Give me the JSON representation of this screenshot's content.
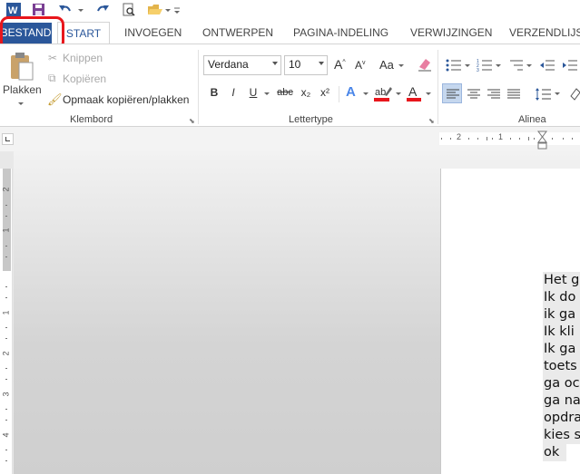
{
  "tabs": {
    "file": "BESTAND",
    "start": "START",
    "insert": "INVOEGEN",
    "design": "ONTWERPEN",
    "layout": "PAGINA-INDELING",
    "references": "VERWIJZINGEN",
    "mailings": "VERZENDLIJSTEN"
  },
  "clipboard": {
    "paste": "Plakken",
    "cut": "Knippen",
    "copy": "Kopiëren",
    "format_painter": "Opmaak kopiëren/plakken",
    "group_label": "Klembord"
  },
  "font": {
    "name": "Verdana",
    "size": "10",
    "group_label": "Lettertype",
    "bold": "B",
    "italic": "I",
    "underline": "U",
    "strike": "abc",
    "subscript": "x₂",
    "superscript": "x²",
    "grow": "A",
    "shrink": "A",
    "case": "Aa"
  },
  "paragraph": {
    "group_label": "Alinea"
  },
  "ruler": {
    "h_marks": [
      "2",
      "1"
    ],
    "v_marks": [
      "2",
      "1",
      "1",
      "2",
      "3",
      "4"
    ]
  },
  "document": {
    "lines": [
      "Het g",
      "Ik do",
      "ik ga",
      "Ik kli",
      "Ik ga",
      "toets",
      "ga oc",
      "ga na",
      "opdra",
      "kies s",
      "ok"
    ]
  },
  "colors": {
    "accent": "#2b579a",
    "highlight_marker": "#e8161c",
    "font_color_bar": "#e8161c"
  },
  "icons": [
    "word-logo-icon",
    "save-icon",
    "undo-icon",
    "redo-icon",
    "print-preview-icon",
    "open-folder-icon",
    "customize-qat-icon"
  ]
}
